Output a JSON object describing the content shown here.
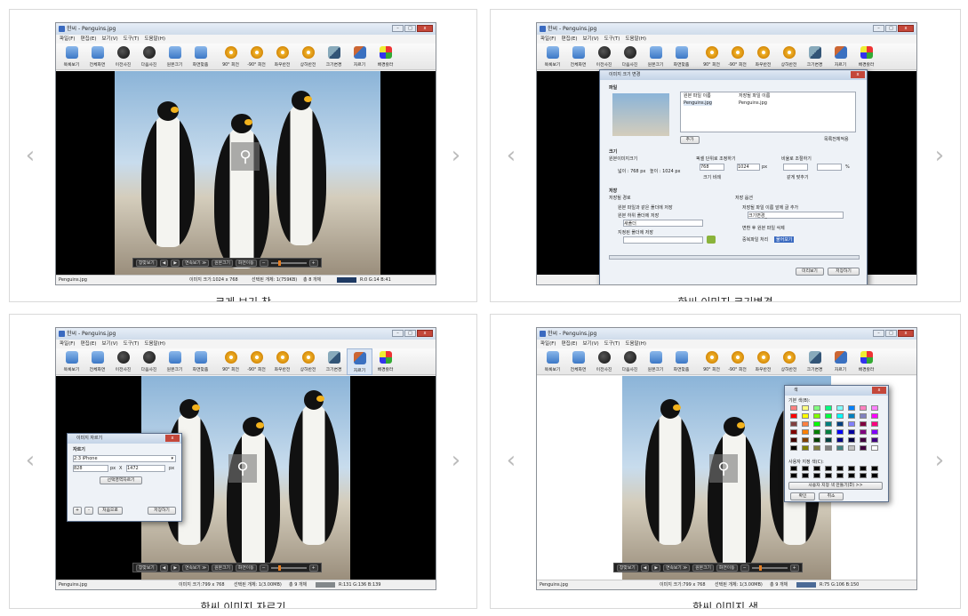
{
  "app": {
    "window_title": "한씨 - Penguins.jpg",
    "menus": [
      "파일(F)",
      "편집(E)",
      "보기(V)",
      "도구(T)",
      "도움말(H)"
    ],
    "toolbar": [
      "목록보기",
      "전체화면",
      "이전사진",
      "다음사진",
      "원본크기",
      "화면맞춤",
      "90° 회전",
      "-90° 회전",
      "좌우반전",
      "상하반전",
      "크기변경",
      "자르기",
      "배경칼라"
    ],
    "control_bar": {
      "fit_label": "창맞보기",
      "slideshow_label": "연속보기 ≫",
      "original_label": "원본크기",
      "fullscreen_label": "화면이동",
      "minus": "−",
      "plus": "+"
    },
    "file_name": "Penguins.jpg"
  },
  "nav": {
    "prev": "‹",
    "next": "›"
  },
  "cards": [
    {
      "caption": "크게 보기 창",
      "status": {
        "size": "이미지 크기:1024 x 768",
        "selected": "선택된 개체: 1(759KB)",
        "count": "총 8 개체",
        "rgb": "R:0 G:14 B:41"
      }
    },
    {
      "caption": "한씨 이미지 크기변경",
      "dialog": {
        "title": "이미지 크기 변경",
        "section_file": "파일",
        "col_original": "원본 파일 이름",
        "col_saved": "저장될 파일 이름",
        "original_name": "Penguins.jpg",
        "saved_name": "Penguins.jpg",
        "add_button": "추가",
        "all_apply": "목록전체적용",
        "section_size": "크기",
        "orig_size_label": "원본이미지크기",
        "width_label": "넓이 : 768 px",
        "height_label": "높이 : 1024 px",
        "pixel_option": "픽셀 단위로 조정하기",
        "pixel_w": "768",
        "pixel_h": "1024",
        "px_unit": "px",
        "keep_ratio": "크기 비례",
        "ratio_option": "비율로 조절하기",
        "percent_unit": "%",
        "same_ratio": "같게 맞추기",
        "section_save": "저장",
        "save_path": "저장될 경로",
        "opt_same_folder": "원본 파일과 같은 폴더에 저장",
        "opt_sub_folder": "원본 하위 폴더에 저장",
        "sub_folder_value": "새폴더",
        "opt_custom_folder": "지정된 폴더에 저장",
        "save_options": "저장 옵션",
        "add_name": "저장될 파일 이름 앞에 글 추가",
        "add_name_value": "크기변경_",
        "delete_original": "변환 후 원본 파일 삭제",
        "dup_label": "중복파일 처리",
        "dup_value": "물어보기",
        "preview_button": "미리보기",
        "save_button": "저장하기"
      }
    },
    {
      "caption": "한씨 이미지 자르기",
      "status": {
        "size": "이미지 크기:799 x 768",
        "selected": "선택된 개체: 1(3.00MB)",
        "count": "총 9 개체",
        "rgb": "R:131 G:136 B:139"
      },
      "dialog": {
        "title": "이미지 자르기",
        "section": "자르기",
        "preset": "2:3 iPhone",
        "width": "828",
        "height": "1472",
        "px_unit": "px",
        "times": "X",
        "select_button": "선택영역자르기",
        "plus_button": "+",
        "minus_button": "-",
        "undo_button": "처음으로",
        "save_button": "저장하기"
      }
    },
    {
      "caption": "한씨 이미지 색",
      "status": {
        "size": "이미지 크기:799 x 768",
        "selected": "선택된 개체: 1(3.00MB)",
        "count": "총 9 개체",
        "rgb": "R:75 G:106 B:150"
      },
      "dialog": {
        "title": "색",
        "basic_colors": "기본 색(B):",
        "custom_colors": "사용자 지정 색(C):",
        "define_button": "사용자 지정 색 만들기(D) >>",
        "ok_button": "확인",
        "cancel_button": "취소",
        "palette": [
          "#ff8080",
          "#ffff80",
          "#80ff80",
          "#00ff80",
          "#80ffff",
          "#0080ff",
          "#ff80c0",
          "#ff80ff",
          "#ff0000",
          "#ffff00",
          "#80ff00",
          "#00ff40",
          "#00ffff",
          "#0080c0",
          "#8080c0",
          "#ff00ff",
          "#804040",
          "#ff8040",
          "#00ff00",
          "#008080",
          "#004080",
          "#8080ff",
          "#800040",
          "#ff0080",
          "#800000",
          "#ff8000",
          "#008000",
          "#008040",
          "#0000ff",
          "#0000a0",
          "#800080",
          "#8000ff",
          "#400000",
          "#804000",
          "#004000",
          "#004040",
          "#000080",
          "#000040",
          "#400040",
          "#400080",
          "#000000",
          "#808000",
          "#808040",
          "#808080",
          "#408080",
          "#c0c0c0",
          "#400040",
          "#ffffff"
        ]
      }
    }
  ]
}
